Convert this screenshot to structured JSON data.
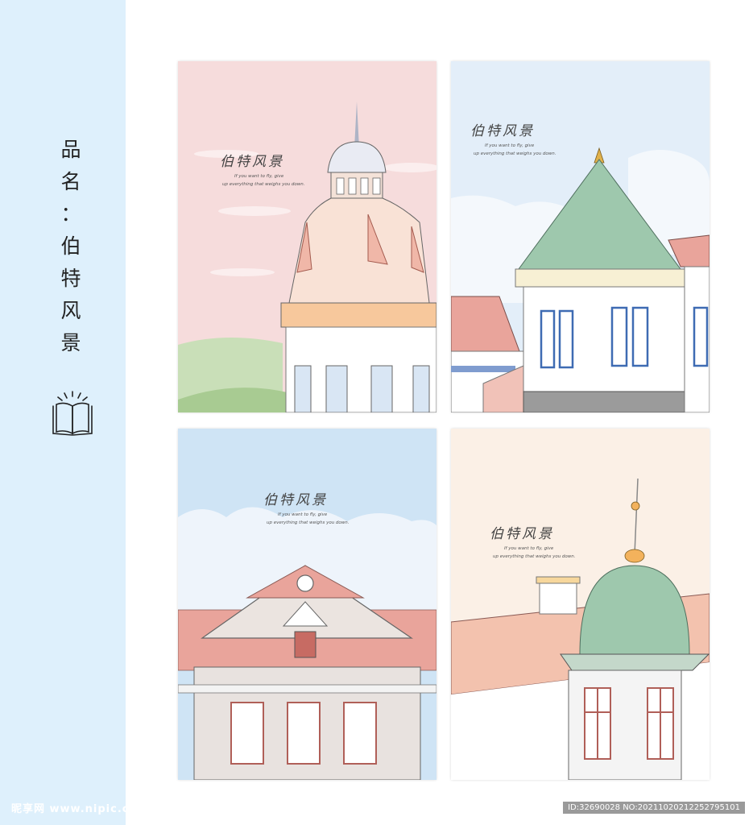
{
  "sidebar": {
    "title_chars": [
      "品",
      "名",
      "：",
      "伯",
      "特",
      "风",
      "景"
    ],
    "bg_color": "#def0fc",
    "icon": "open-book-icon"
  },
  "cards": [
    {
      "title": "伯特风景",
      "sub1": "If you want to fly, give",
      "sub2": "up everything that weighs you down.",
      "theme": "#f6dcdc"
    },
    {
      "title": "伯特风景",
      "sub1": "If you want to fly, give",
      "sub2": "up everything that weighs you down.",
      "theme": "#e3eef9"
    },
    {
      "title": "伯特风景",
      "sub1": "If you want to fly, give",
      "sub2": "up everything that weighs you down.",
      "theme": "#cfe4f5"
    },
    {
      "title": "伯特风景",
      "sub1": "If you want to fly, give",
      "sub2": "up everything that weighs you down.",
      "theme": "#fbf0e6"
    }
  ],
  "watermark": {
    "left": "昵享网 www.nipic.cn",
    "right": "ID:32690028 NO:20211020212252795101"
  }
}
